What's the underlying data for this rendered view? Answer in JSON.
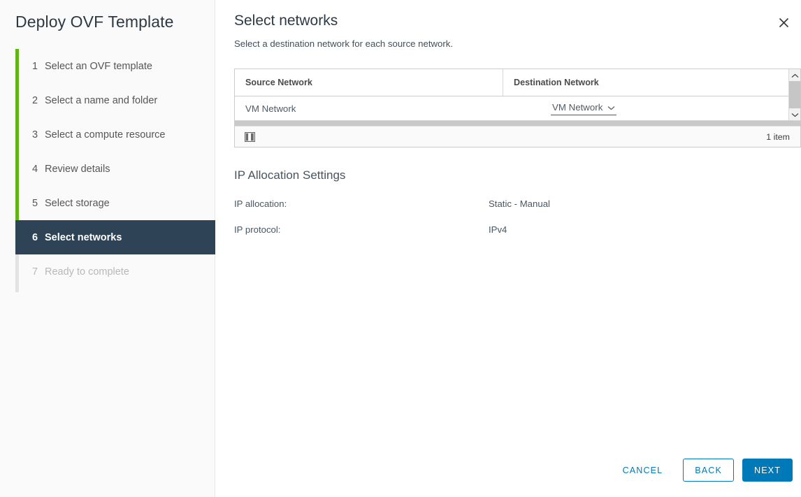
{
  "wizard": {
    "title": "Deploy OVF Template",
    "steps": [
      {
        "num": "1",
        "label": "Select an OVF template",
        "state": "done"
      },
      {
        "num": "2",
        "label": "Select a name and folder",
        "state": "done"
      },
      {
        "num": "3",
        "label": "Select a compute resource",
        "state": "done"
      },
      {
        "num": "4",
        "label": "Review details",
        "state": "done"
      },
      {
        "num": "5",
        "label": "Select storage",
        "state": "done"
      },
      {
        "num": "6",
        "label": "Select networks",
        "state": "active"
      },
      {
        "num": "7",
        "label": "Ready to complete",
        "state": "disabled"
      }
    ],
    "progress_color": "#60b515",
    "active_color": "#2e4355"
  },
  "page": {
    "title": "Select networks",
    "subtitle": "Select a destination network for each source network.",
    "close_icon": "close-icon"
  },
  "grid": {
    "columns": [
      "Source Network",
      "Destination Network"
    ],
    "rows": [
      {
        "source": "VM Network",
        "destination": "VM Network"
      }
    ],
    "destination_chevron_icon": "chevron-down-icon",
    "footer": {
      "column_picker_icon": "columns-icon",
      "item_count": "1 item"
    },
    "scrollbar": {
      "up_icon": "chevron-up-icon",
      "down_icon": "chevron-down-icon"
    }
  },
  "ip_settings": {
    "title": "IP Allocation Settings",
    "rows": [
      {
        "label": "IP allocation:",
        "value": "Static - Manual"
      },
      {
        "label": "IP protocol:",
        "value": "IPv4"
      }
    ]
  },
  "actions": {
    "cancel": "CANCEL",
    "back": "BACK",
    "next": "NEXT",
    "accent_color": "#0079b8"
  }
}
